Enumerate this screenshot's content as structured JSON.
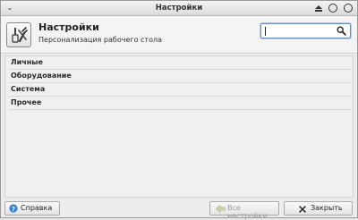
{
  "window": {
    "title": "Настройки"
  },
  "header": {
    "title": "Настройки",
    "subtitle": "Персонализация рабочего стола"
  },
  "search": {
    "value": ""
  },
  "categories": [
    {
      "label": "Личные"
    },
    {
      "label": "Оборудование"
    },
    {
      "label": "Система"
    },
    {
      "label": "Прочее"
    }
  ],
  "footer": {
    "help_label": "Справка",
    "all_settings_label": "Все настройки",
    "close_label": "Закрыть"
  },
  "icons": {
    "window_menu": "chevron-down-icon",
    "shade": "shade-icon",
    "maximize": "maximize-icon",
    "close": "close-icon",
    "app": "settings-tools-icon",
    "search": "search-icon",
    "help": "help-icon",
    "all_settings": "arrow-left-icon",
    "close_button": "close-x-icon"
  },
  "colors": {
    "search_focus": "#6a8fbf",
    "help_icon": "#3b7fd0"
  }
}
